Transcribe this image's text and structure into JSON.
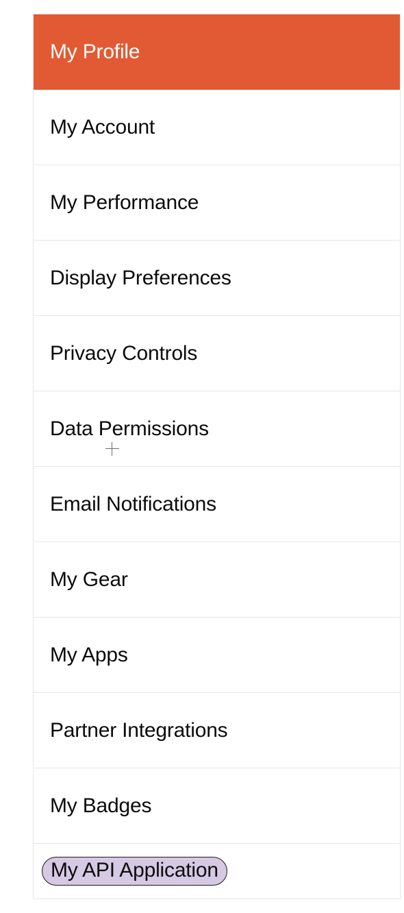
{
  "menu": {
    "accent": "#e25a33",
    "highlight_bg": "#d6c9e3",
    "items": [
      {
        "label": "My Profile",
        "active": true,
        "highlighted": false
      },
      {
        "label": "My Account",
        "active": false,
        "highlighted": false
      },
      {
        "label": "My Performance",
        "active": false,
        "highlighted": false
      },
      {
        "label": "Display Preferences",
        "active": false,
        "highlighted": false
      },
      {
        "label": "Privacy Controls",
        "active": false,
        "highlighted": false
      },
      {
        "label": "Data Permissions",
        "active": false,
        "highlighted": false
      },
      {
        "label": "Email Notifications",
        "active": false,
        "highlighted": false
      },
      {
        "label": "My Gear",
        "active": false,
        "highlighted": false
      },
      {
        "label": "My Apps",
        "active": false,
        "highlighted": false
      },
      {
        "label": "Partner Integrations",
        "active": false,
        "highlighted": false
      },
      {
        "label": "My Badges",
        "active": false,
        "highlighted": false
      },
      {
        "label": "My API Application",
        "active": false,
        "highlighted": true
      }
    ]
  }
}
